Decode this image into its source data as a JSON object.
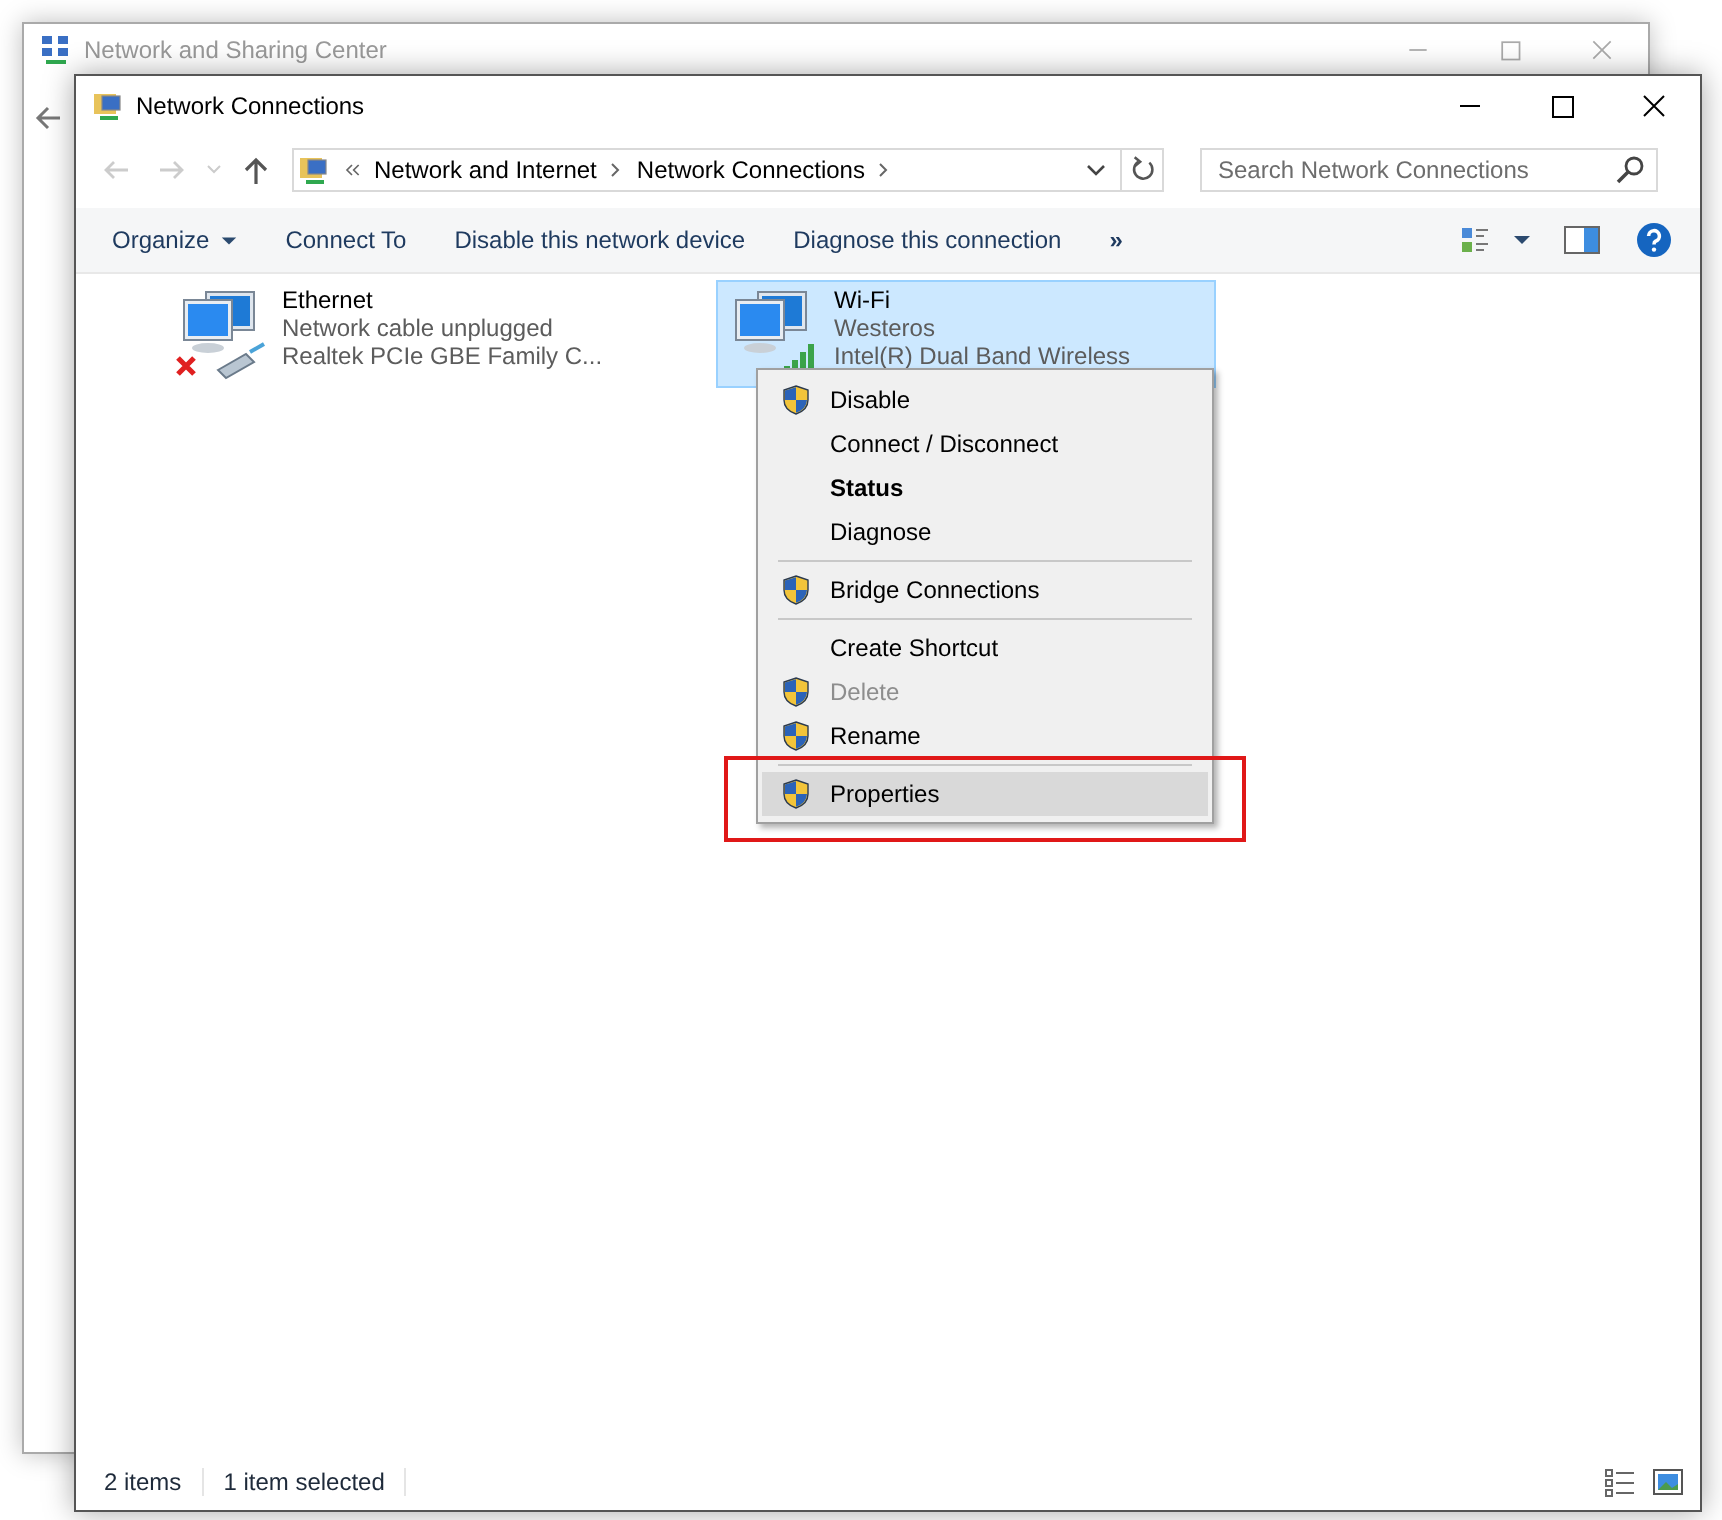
{
  "back_window": {
    "title": "Network and Sharing Center"
  },
  "window": {
    "title": "Network Connections"
  },
  "address_bar": {
    "crumbs": [
      "Network and Internet",
      "Network Connections"
    ]
  },
  "search": {
    "placeholder": "Search Network Connections"
  },
  "toolbar": {
    "items": [
      {
        "label": "Organize",
        "dropdown": true
      },
      {
        "label": "Connect To",
        "dropdown": false
      },
      {
        "label": "Disable this network device",
        "dropdown": false
      },
      {
        "label": "Diagnose this connection",
        "dropdown": false
      }
    ],
    "overflow": "»"
  },
  "connections": [
    {
      "kind": "wired",
      "name": "Ethernet",
      "status": "Network cable unplugged",
      "device": "Realtek PCIe GBE Family C...",
      "disconnected": true,
      "selected": false
    },
    {
      "kind": "wireless",
      "name": "Wi-Fi",
      "status": "Westeros",
      "device": "Intel(R) Dual Band Wireless",
      "disconnected": false,
      "selected": true
    }
  ],
  "context_menu": {
    "items": [
      {
        "kind": "item",
        "label": "Disable",
        "shield": true,
        "bold": false,
        "disabled": false,
        "selected": false
      },
      {
        "kind": "item",
        "label": "Connect / Disconnect",
        "shield": false,
        "bold": false,
        "disabled": false,
        "selected": false
      },
      {
        "kind": "item",
        "label": "Status",
        "shield": false,
        "bold": true,
        "disabled": false,
        "selected": false
      },
      {
        "kind": "item",
        "label": "Diagnose",
        "shield": false,
        "bold": false,
        "disabled": false,
        "selected": false
      },
      {
        "kind": "separator"
      },
      {
        "kind": "item",
        "label": "Bridge Connections",
        "shield": true,
        "bold": false,
        "disabled": false,
        "selected": false
      },
      {
        "kind": "separator"
      },
      {
        "kind": "item",
        "label": "Create Shortcut",
        "shield": false,
        "bold": false,
        "disabled": false,
        "selected": false
      },
      {
        "kind": "item",
        "label": "Delete",
        "shield": true,
        "bold": false,
        "disabled": true,
        "selected": false
      },
      {
        "kind": "item",
        "label": "Rename",
        "shield": true,
        "bold": false,
        "disabled": false,
        "selected": false
      },
      {
        "kind": "separator"
      },
      {
        "kind": "item",
        "label": "Properties",
        "shield": true,
        "bold": false,
        "disabled": false,
        "selected": true
      }
    ]
  },
  "status_bar": {
    "count": "2 items",
    "selection": "1 item selected"
  }
}
